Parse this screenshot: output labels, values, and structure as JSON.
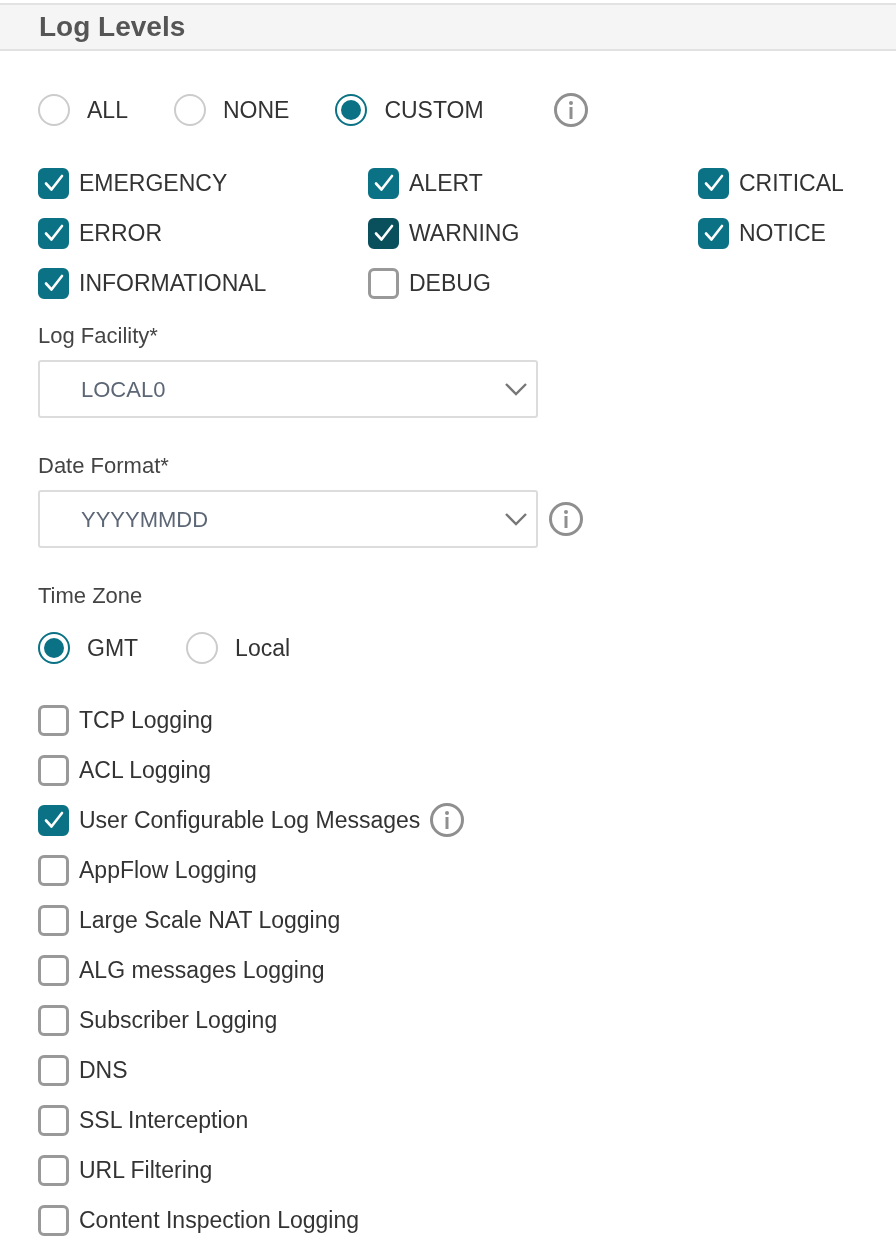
{
  "section": {
    "title": "Log Levels"
  },
  "level_mode": [
    {
      "label": "ALL",
      "selected": false
    },
    {
      "label": "NONE",
      "selected": false
    },
    {
      "label": "CUSTOM",
      "selected": true
    }
  ],
  "levels": [
    {
      "label": "EMERGENCY",
      "checked": true
    },
    {
      "label": "ALERT",
      "checked": true
    },
    {
      "label": "CRITICAL",
      "checked": true
    },
    {
      "label": "ERROR",
      "checked": true
    },
    {
      "label": "WARNING",
      "checked": true,
      "focused": true
    },
    {
      "label": "NOTICE",
      "checked": true
    },
    {
      "label": "INFORMATIONAL",
      "checked": true
    },
    {
      "label": "DEBUG",
      "checked": false
    }
  ],
  "fields": [
    {
      "label": "Log Facility*",
      "value": "LOCAL0"
    },
    {
      "label": "Date Format*",
      "value": "YYYYMMDD",
      "info": true
    }
  ],
  "time_zone": {
    "label": "Time Zone",
    "options": [
      {
        "label": "GMT",
        "selected": true
      },
      {
        "label": "Local",
        "selected": false
      }
    ]
  },
  "options": [
    {
      "label": "TCP Logging",
      "checked": false
    },
    {
      "label": "ACL Logging",
      "checked": false
    },
    {
      "label": "User Configurable Log Messages",
      "checked": true,
      "info": true
    },
    {
      "label": "AppFlow Logging",
      "checked": false
    },
    {
      "label": "Large Scale NAT Logging",
      "checked": false
    },
    {
      "label": "ALG messages Logging",
      "checked": false
    },
    {
      "label": "Subscriber Logging",
      "checked": false
    },
    {
      "label": "DNS",
      "checked": false
    },
    {
      "label": "SSL Interception",
      "checked": false
    },
    {
      "label": "URL Filtering",
      "checked": false
    },
    {
      "label": "Content Inspection Logging",
      "checked": false
    }
  ]
}
